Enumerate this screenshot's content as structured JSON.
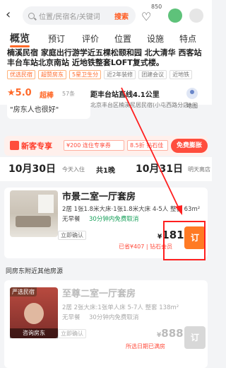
{
  "header": {
    "search_placeholder": "位置/民宿名/关键词",
    "search_button": "搜索",
    "favorite_count": "850",
    "back_icon": "back-arrow-icon",
    "favorite_icon": "heart-icon"
  },
  "tabs": [
    "概览",
    "预订",
    "评价",
    "位置",
    "设施",
    "特点"
  ],
  "hotel": {
    "name": "楠溪民宿 家庭出行游学近五棵松颐和园 北大清华 西客站丰台车站北京南站 近地铁整套LOFT复式楼。",
    "tags": [
      "优选民宿",
      "超赞房东",
      "5星卫生分",
      "近2年装修",
      "团建会议",
      "近地铁"
    ],
    "score": "5.0",
    "score_label": "超棒",
    "review_count": "57条",
    "review_quote": "\"房东人也很好\"",
    "distance": "距丰台站直线4.1公里",
    "address": "北京丰台区楠溪民居民宿(小屯西路分店)",
    "map_label": "地图"
  },
  "promo": {
    "title": "新客专享",
    "coupons": [
      "¥200 连住专享券",
      "8.5折 钻石佳"
    ],
    "boost_button": "免费膨胀"
  },
  "dates": {
    "checkin": "10月30日",
    "checkin_sub": "今天入住",
    "nights": "共1晚",
    "checkout": "10月31日",
    "checkout_sub": "明天离店"
  },
  "room1": {
    "title": "市景二室一厅套房",
    "desc": "2居 1张1.8米大床·1张1.8米大床 4-5人 整套 63m²",
    "meal": "无早餐",
    "cancel": "30分钟内免费取消",
    "confirm": "立即确认",
    "currency": "¥",
    "price": "181",
    "saved": "已省¥407 | 钻石会员",
    "book": "订"
  },
  "section_title": "同房东附近其他房源",
  "room2": {
    "label": "严选民宿",
    "caption": "咨询房东",
    "title": "至尊二室一厅套房",
    "desc": "2居 2张大床:1张单人床 5-7人 整套 138m²",
    "meal": "无早餐",
    "cancel": "30分钟内免费取消",
    "confirm": "立即确认",
    "currency": "¥",
    "price": "888",
    "full": "所选日期已满房",
    "book": "订"
  },
  "colors": {
    "accent": "#ff6a2a",
    "book_button": "#ff7a24",
    "annotation_box": "#ff1f1f"
  }
}
